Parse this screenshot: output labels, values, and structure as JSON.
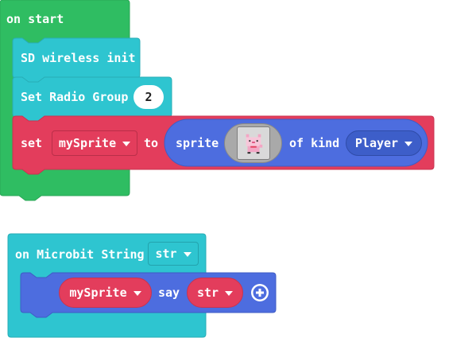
{
  "colors": {
    "on_start": "#2fbd62",
    "wireless": "#2ec5d0",
    "sprites": "#e33d5c",
    "sprite_shadow": "#6a7fc8",
    "variables": "#e33d5c",
    "dropdown_dark": "#3d5ec9",
    "string_event": "#2ec5d0",
    "say_block": "#4d6ddf"
  },
  "on_start": {
    "label": "on start",
    "init_label": "SD wireless init",
    "radio_group": {
      "label": "Set Radio Group",
      "value": "2"
    },
    "set_block": {
      "set_label": "set",
      "variable": "mySprite",
      "to_label": "to",
      "sprite_label": "sprite",
      "sprite_image_icon": "pink-cat-sprite-icon",
      "kind_label": "of kind",
      "kind_value": "Player"
    }
  },
  "on_string": {
    "label": "on Microbit String",
    "param": "str",
    "say_block": {
      "sprite_var": "mySprite",
      "say_label": "say",
      "arg_var": "str",
      "add_icon": "plus-circle-icon"
    }
  }
}
